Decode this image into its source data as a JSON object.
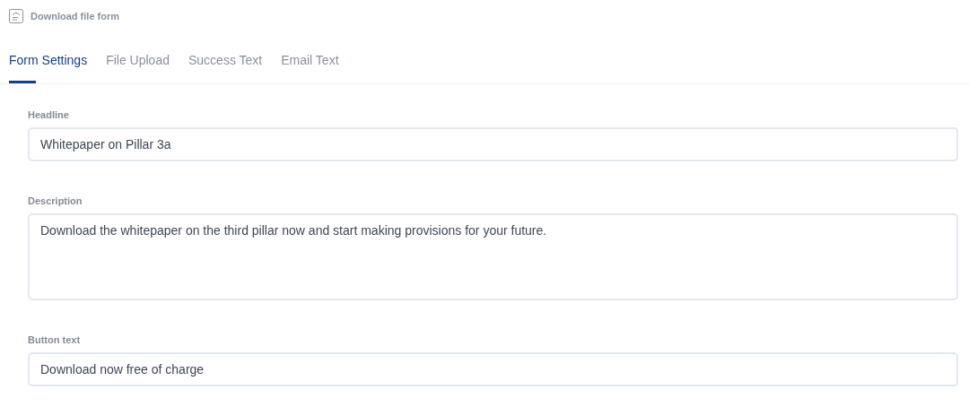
{
  "header": {
    "title": "Download file form"
  },
  "tabs": [
    {
      "label": "Form Settings",
      "selected": true
    },
    {
      "label": "File Upload",
      "selected": false
    },
    {
      "label": "Success Text",
      "selected": false
    },
    {
      "label": "Email Text",
      "selected": false
    }
  ],
  "fields": [
    {
      "kind": "input",
      "label": "Headline",
      "value": "Whitepaper on Pillar 3a"
    },
    {
      "kind": "textarea",
      "label": "Description",
      "value": "Download the whitepaper on the third pillar now and start making provisions for your future."
    },
    {
      "kind": "input",
      "label": "Button text",
      "value": "Download now free of charge"
    }
  ]
}
